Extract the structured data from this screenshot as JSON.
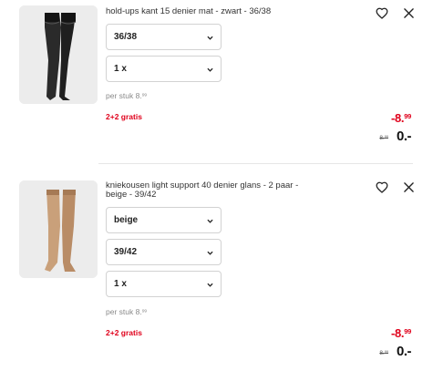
{
  "items": [
    {
      "title": "hold-ups kant 15 denier mat - zwart - 36/38",
      "image_icon": "stockings-icon",
      "selects": [
        "36/38",
        "1 x"
      ],
      "per_stuk_label": "per stuk 8.",
      "per_stuk_cents": "99",
      "promo": "2+2 gratis",
      "discount_main": "-8.",
      "discount_cents": "99",
      "old_price_main": "8.",
      "old_price_cents": "99",
      "new_price": "0.-"
    },
    {
      "title": "kniekousen light support 40 denier glans - 2 paar - beige - 39/42",
      "image_icon": "knee-socks-icon",
      "selects": [
        "beige",
        "39/42",
        "1 x"
      ],
      "per_stuk_label": "per stuk 8.",
      "per_stuk_cents": "99",
      "promo": "2+2 gratis",
      "discount_main": "-8.",
      "discount_cents": "99",
      "old_price_main": "8.",
      "old_price_cents": "99",
      "new_price": "0.-"
    }
  ],
  "icons": {
    "favorite": "heart-outline-icon",
    "remove": "close-icon",
    "dropdown": "chevron-down-icon"
  },
  "colors": {
    "promo_red": "#e0001b",
    "text": "#333333",
    "border": "#d2d2d2"
  }
}
